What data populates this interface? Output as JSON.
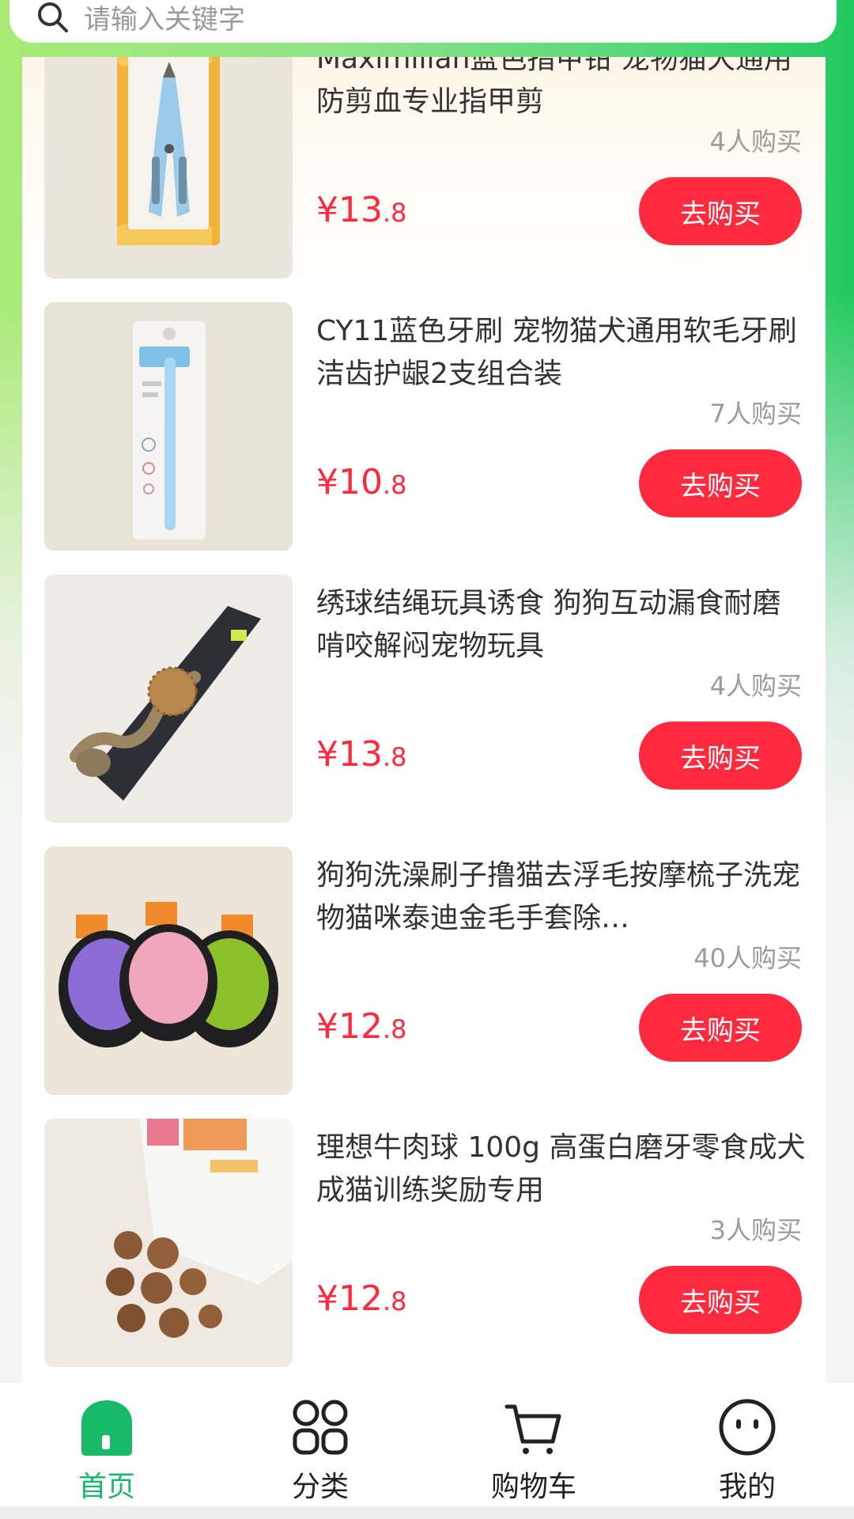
{
  "search": {
    "placeholder": "请输入关键字"
  },
  "products": [
    {
      "title": "Maximilian蓝色指甲钳 宠物猫犬通用防剪血专业指甲剪",
      "buyers": "4人购买",
      "price_symbol": "¥",
      "price_int": "13",
      "price_dec": ".8",
      "buy_label": "去购买"
    },
    {
      "title": "CY11蓝色牙刷 宠物猫犬通用软毛牙刷洁齿护龈2支组合装",
      "buyers": "7人购买",
      "price_symbol": "¥",
      "price_int": "10",
      "price_dec": ".8",
      "buy_label": "去购买"
    },
    {
      "title": "绣球结绳玩具诱食 狗狗互动漏食耐磨啃咬解闷宠物玩具",
      "buyers": "4人购买",
      "price_symbol": "¥",
      "price_int": "13",
      "price_dec": ".8",
      "buy_label": "去购买"
    },
    {
      "title": "狗狗洗澡刷子撸猫去浮毛按摩梳子洗宠物猫咪泰迪金毛手套除…",
      "buyers": "40人购买",
      "price_symbol": "¥",
      "price_int": "12",
      "price_dec": ".8",
      "buy_label": "去购买"
    },
    {
      "title": "理想牛肉球 100g 高蛋白磨牙零食成犬成猫训练奖励专用",
      "buyers": "3人购买",
      "price_symbol": "¥",
      "price_int": "12",
      "price_dec": ".8",
      "buy_label": "去购买"
    }
  ],
  "tabbar": {
    "items": [
      {
        "label": "首页",
        "icon": "home-icon",
        "active": true
      },
      {
        "label": "分类",
        "icon": "category-grid-icon",
        "active": false
      },
      {
        "label": "购物车",
        "icon": "cart-icon",
        "active": false
      },
      {
        "label": "我的",
        "icon": "profile-face-icon",
        "active": false
      }
    ]
  },
  "colors": {
    "accent_green": "#19b96a",
    "price_red": "#ff2a3d",
    "button_red": "#ff2a3d",
    "gradient_left": "#a8ea74",
    "gradient_right": "#22c95f"
  }
}
